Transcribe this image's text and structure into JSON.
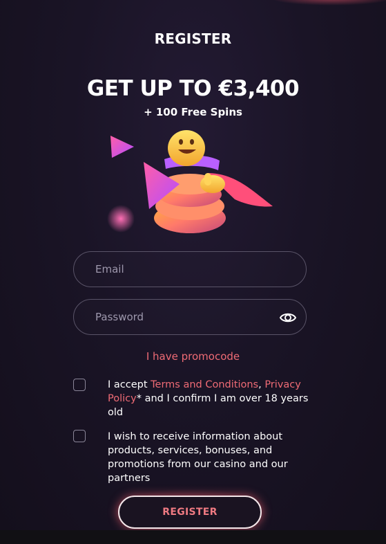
{
  "header": {
    "title": "REGISTER"
  },
  "promo": {
    "headline": "GET UP TO €3,400",
    "subline": "+ 100 Free Spins"
  },
  "form": {
    "email": {
      "placeholder": "Email",
      "value": ""
    },
    "password": {
      "placeholder": "Password",
      "value": ""
    },
    "promocode_link": "I have promocode",
    "terms": {
      "prefix": "I accept ",
      "terms_link": "Terms and Conditions",
      "comma": ",",
      "privacy_link": "Privacy Policy",
      "suffix": "* and I confirm I am over 18 years old",
      "checked": false
    },
    "marketing": {
      "text": "I wish to receive information about products, services, bonuses, and promotions from our casino and our partners",
      "checked": false
    },
    "submit_label": "REGISTER"
  },
  "icons": {
    "password_toggle": "eye-icon",
    "illustration": "mascot-illustration"
  },
  "colors": {
    "background": "#1a1426",
    "accent": "#ef6b75",
    "button_border": "#f4e7ea"
  }
}
